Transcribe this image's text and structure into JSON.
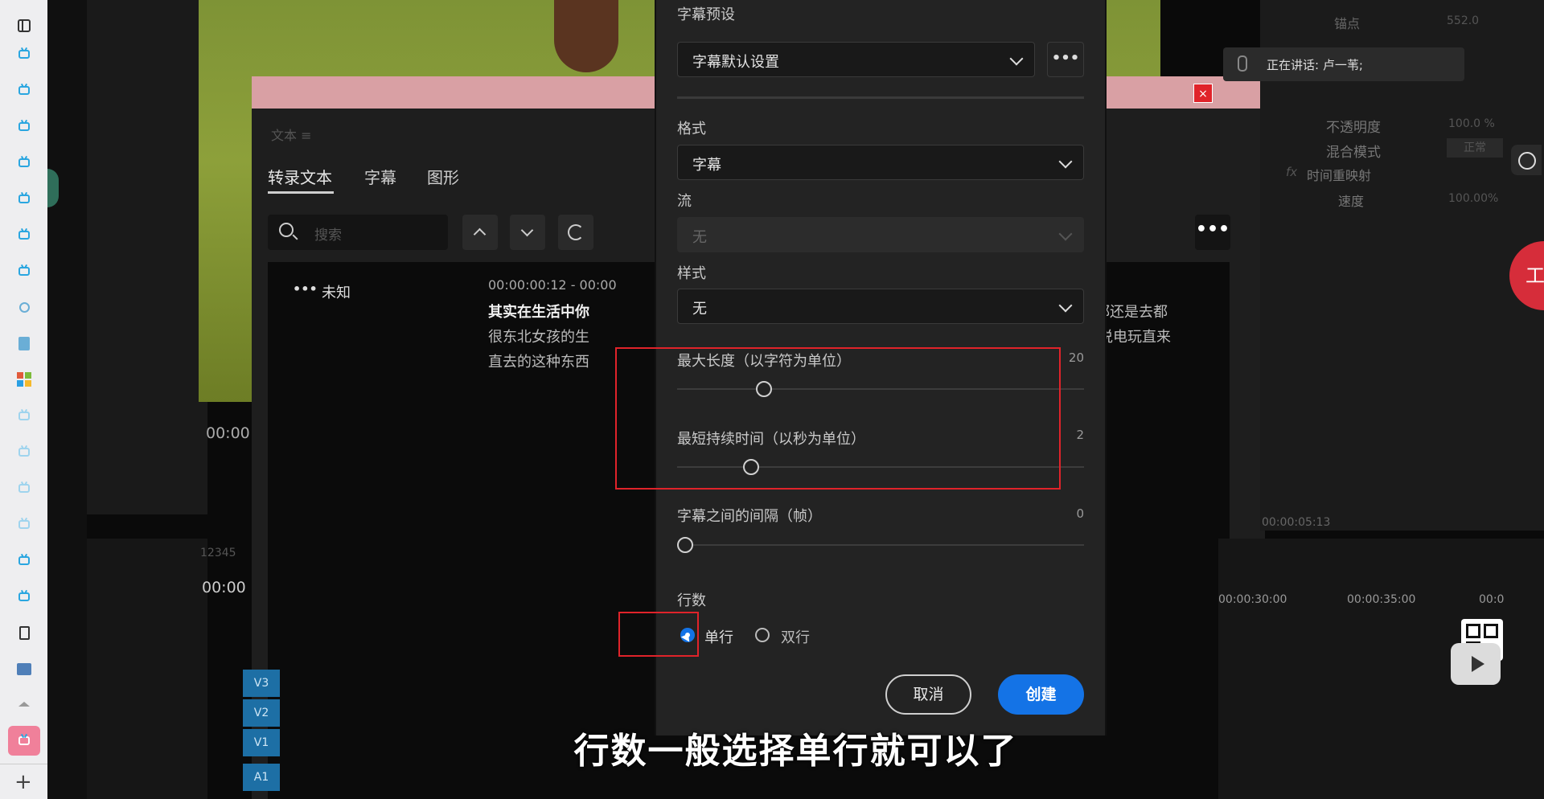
{
  "sidebar": {
    "top_icon": "panel-toggle-icon",
    "items": [
      "bilibili-icon",
      "bilibili-icon",
      "bilibili-icon",
      "bilibili-icon",
      "bilibili-icon",
      "bilibili-icon",
      "bilibili-icon",
      "search-icon",
      "document-icon",
      "windows-icon",
      "bilibili-icon",
      "bilibili-icon",
      "bilibili-icon",
      "bilibili-icon",
      "bilibili-icon",
      "bilibili-icon",
      "file-icon",
      "ai-icon",
      "arrows-icon",
      "bilibili-active-icon"
    ],
    "add_label": "+"
  },
  "premiere": {
    "text_panel_title": "文本 ≡",
    "tabs": [
      "转录文本",
      "字幕",
      "图形"
    ],
    "search_placeholder": "搜索",
    "speaker": "未知",
    "timecode": "00:00:00:12 - 00:00",
    "transcript_line1": "其实在生活中你",
    "transcript_line2": "很东北女孩的生",
    "transcript_line3": "直去的这种东西",
    "transcript_right1": "本上都还是去都",
    "transcript_right2": "比如说电玩直来",
    "left_timecode1": "00:00",
    "left_timecode2": "00:00",
    "sequence_tab": "12345",
    "tracks": [
      "V3",
      "V2",
      "V1",
      "A1"
    ],
    "ruler": [
      "00:00:30:00",
      "00:00:35:00",
      "00:0"
    ],
    "right_panel": {
      "anchor": "锚点",
      "anchor_val": "552.0",
      "opacity": "不透明度",
      "opacity_val": "100.0 %",
      "blend": "混合模式",
      "blend_val": "正常",
      "time_remap": "时间重映射",
      "speed": "速度",
      "speed_val": "100.00%",
      "fx": "fx",
      "timecode": "00:00:05:13"
    }
  },
  "dialog": {
    "preset_label": "字幕预设",
    "preset_value": "字幕默认设置",
    "format_label": "格式",
    "format_value": "字幕",
    "stream_label": "流",
    "stream_value": "无",
    "style_label": "样式",
    "style_value": "无",
    "max_length_label": "最大长度（以字符为单位）",
    "max_length_value": "20",
    "max_length_level": 0.19,
    "min_duration_label": "最短持续时间（以秒为单位）",
    "min_duration_value": "2",
    "min_duration_level": 0.17,
    "gap_label": "字幕之间的间隔（帧）",
    "gap_value": "0",
    "gap_level": 0.0,
    "lines_label": "行数",
    "single_line": "单行",
    "double_line": "双行",
    "selected_lines": "单行",
    "cancel": "取消",
    "create": "创建"
  },
  "speaking_notice": "正在讲话: 卢一苇;",
  "subtitle": "行数一般选择单行就可以了",
  "colors": {
    "accent": "#1473e6",
    "highlight": "#e0232a",
    "pink_bar": "#d9a0a4",
    "video_green": "#7d8a2a"
  }
}
